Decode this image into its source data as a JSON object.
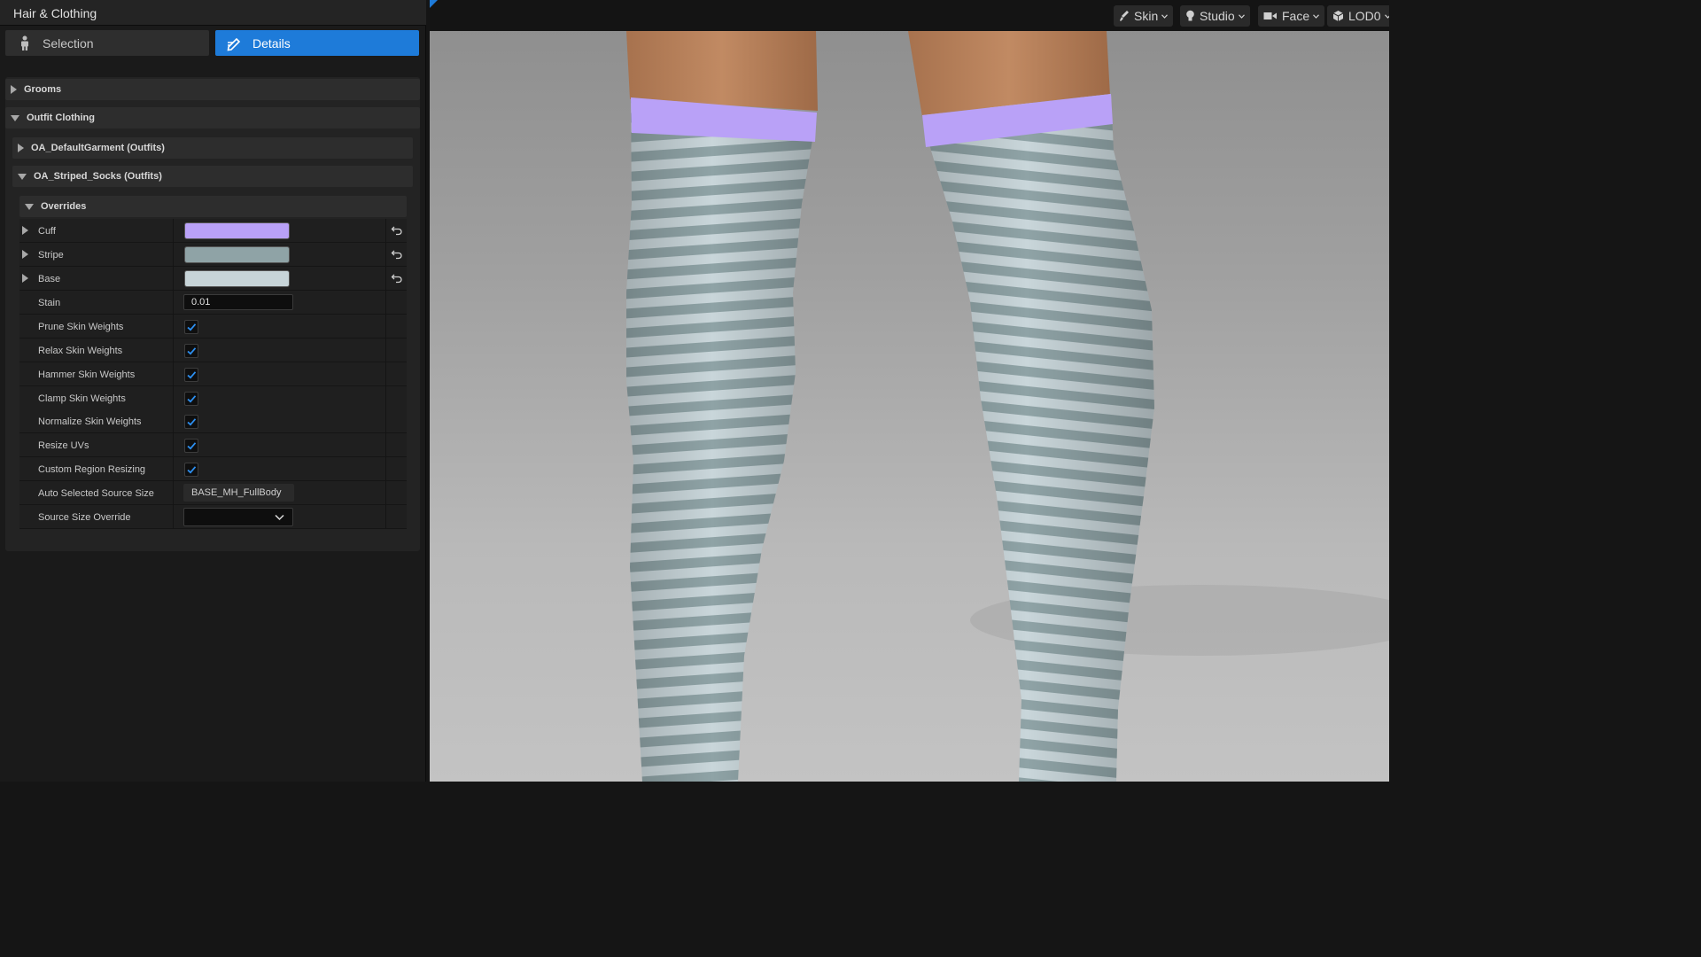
{
  "panel": {
    "title": "Hair & Clothing",
    "selection_label": "Selection",
    "details_label": "Details"
  },
  "categories": {
    "grooms": "Grooms",
    "outfit_clothing": "Outfit Clothing",
    "default_garment": "OA_DefaultGarment (Outfits)",
    "striped_socks": "OA_Striped_Socks (Outfits)",
    "overrides": "Overrides"
  },
  "properties": {
    "cuff": {
      "label": "Cuff",
      "color": "#b9a1f7"
    },
    "stripe": {
      "label": "Stripe",
      "color": "#8fa3a6"
    },
    "base": {
      "label": "Base",
      "color": "#c7d4d8"
    },
    "stain": {
      "label": "Stain",
      "value": "0.01"
    },
    "prune": {
      "label": "Prune Skin Weights",
      "checked": true
    },
    "relax": {
      "label": "Relax Skin Weights",
      "checked": true
    },
    "hammer": {
      "label": "Hammer Skin Weights",
      "checked": true
    },
    "clamp": {
      "label": "Clamp Skin Weights",
      "checked": true
    },
    "normalize": {
      "label": "Normalize Skin Weights",
      "checked": true
    },
    "resize_uvs": {
      "label": "Resize UVs",
      "checked": true
    },
    "custom_region": {
      "label": "Custom Region Resizing",
      "checked": true
    },
    "auto_source": {
      "label": "Auto Selected Source Size",
      "value": "BASE_MH_FullBody"
    },
    "source_override": {
      "label": "Source Size Override",
      "value": ""
    }
  },
  "viewport": {
    "skin_label": "Skin",
    "studio_label": "Studio",
    "face_label": "Face",
    "lod_label": "LOD0"
  },
  "colors": {
    "accent": "#1e7bd9",
    "cuff_purple": "#b9a1f7",
    "stripe_gray": "#8fa3a6",
    "base_light": "#c7d4d8"
  }
}
